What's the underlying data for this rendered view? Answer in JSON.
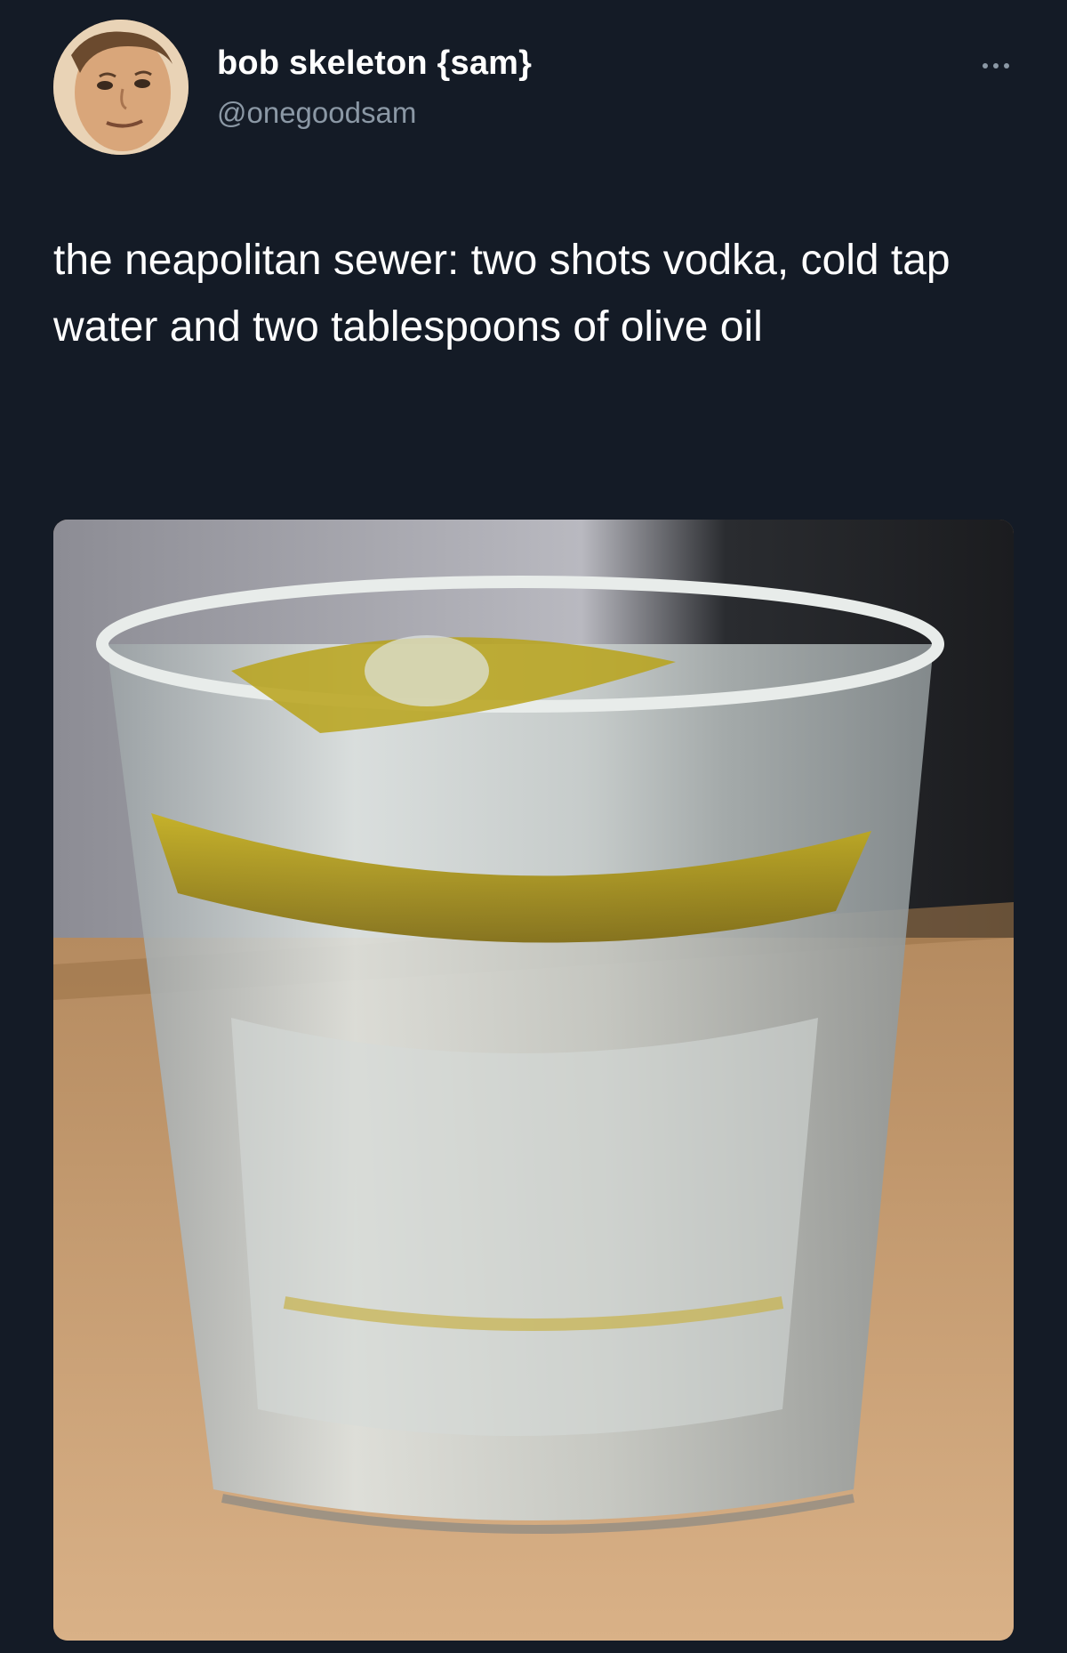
{
  "tweet": {
    "display_name": "bob skeleton {sam}",
    "handle": "@onegoodsam",
    "text": "the neapolitan sewer: two shots vodka, cold tap water and two tablespoons of olive oil",
    "avatar_icon": "user-avatar-photo",
    "more_icon": "more-horizontal-icon",
    "media_description_icon": "drink-photo"
  },
  "colors": {
    "background": "#141b26",
    "name": "#ffffff",
    "handle": "#8b98a5",
    "text": "#ffffff"
  }
}
